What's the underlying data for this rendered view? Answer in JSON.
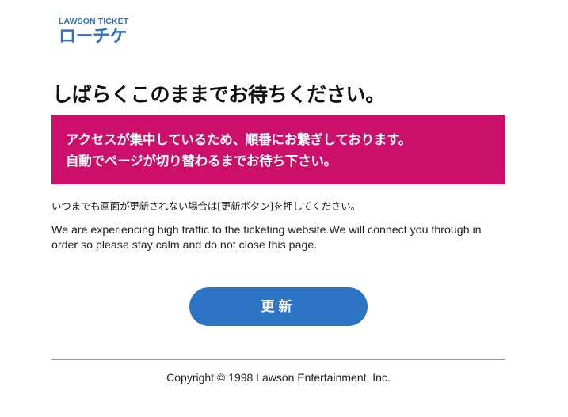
{
  "logo": {
    "top": "LAWSON TICKET",
    "main": "ローチケ",
    "color": "#2b72c2"
  },
  "title": "しばらくこのままでお待ちください。",
  "notice": {
    "lines": [
      "アクセスが集中しているため、順番にお繋ぎしております。",
      "自動でページが切り替わるまでお待ち下さい。"
    ],
    "background": "#cc0f6b"
  },
  "instruction_jp": "いつまでも画面が更新されない場合は[更新ボタン]を押してください。",
  "instruction_en": "We are experiencing high traffic to the ticketing website.We will connect you through in order so please stay calm and do not close this page.",
  "refresh_button": {
    "label": "更新",
    "color": "#2d74c4"
  },
  "footer": {
    "copyright": "Copyright © 1998 Lawson Entertainment, Inc."
  }
}
